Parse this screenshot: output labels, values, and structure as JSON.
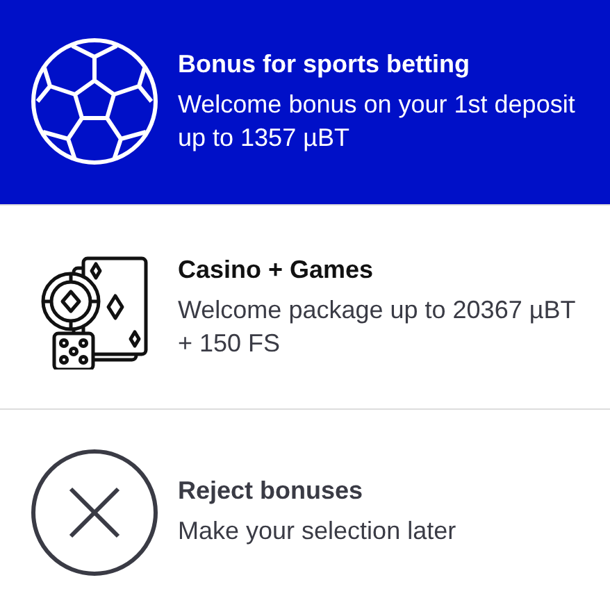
{
  "options": [
    {
      "kind": "sports",
      "title": "Bonus for sports betting",
      "description": "Welcome bonus on your 1st deposit up to 1357 µBT",
      "selected": true
    },
    {
      "kind": "casino",
      "title": "Casino + Games",
      "description": "Welcome package up to 20367 µBT + 150 FS",
      "selected": false
    },
    {
      "kind": "reject",
      "title": "Reject bonuses",
      "description": "Make your selection later",
      "selected": false
    }
  ]
}
